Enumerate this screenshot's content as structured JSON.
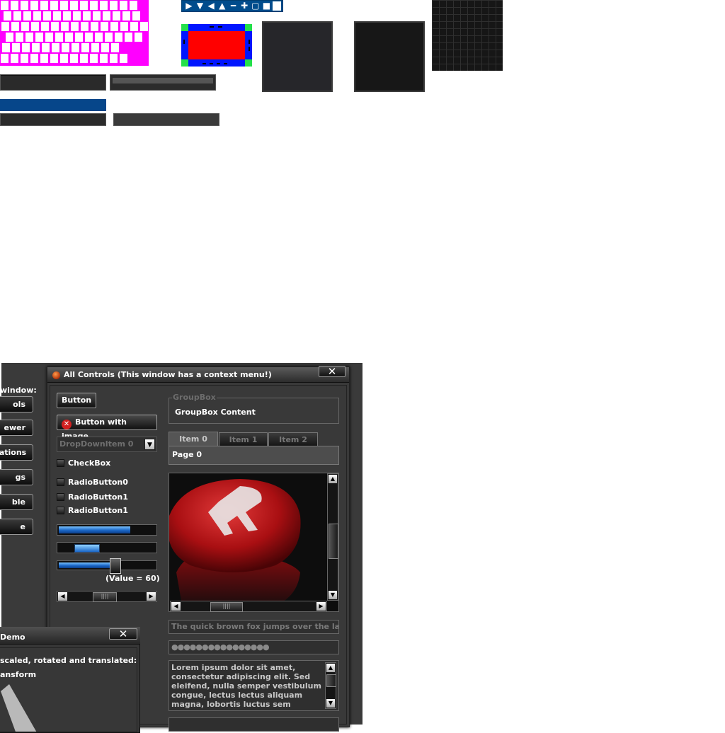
{
  "colors": {
    "magenta": "#ff00ff",
    "blue": "#004c8c",
    "red": "#ff0000",
    "green": "#23e04a",
    "dark": "#393939"
  },
  "atlas": {
    "strip_icons": [
      "triangle-right-icon",
      "triangle-down-icon",
      "triangle-left-icon",
      "triangle-up-icon",
      "minus-icon",
      "plus-icon",
      "square-outline-icon",
      "square-filled-icon"
    ],
    "strip_glyphs": [
      "▶",
      "▼",
      "◀",
      "▲",
      "━",
      "✚",
      "▢",
      "■"
    ]
  },
  "sidebar": {
    "label": "window:",
    "buttons": [
      "ols",
      "ewer",
      "nations",
      "gs",
      "ble",
      "e"
    ]
  },
  "window": {
    "title": "All Controls (This window has a context menu!)",
    "close_glyph": "✕",
    "button_label": "Button",
    "image_button_label": "Button with image",
    "image_button_icon": "✕",
    "dropdown_value": "DropDownItem 0",
    "dropdown_arrow": "▼",
    "checkbox_label": "CheckBox",
    "radio_labels": [
      "RadioButton0",
      "RadioButton1",
      "RadioButton1"
    ],
    "progress_fraction": 0.74,
    "slider_value_label": "(Value = 60)",
    "slider_fraction": 0.6,
    "groupbox_title": "GroupBox",
    "groupbox_content": "GroupBox Content",
    "tabs": [
      "Item 0",
      "Item 1",
      "Item 2"
    ],
    "tab_page": "Page 0",
    "picture_letter": "R",
    "edit_text": "The quick brown fox jumps over the lazy dog",
    "password_text": "●●●●●●●●●●●●●●●●",
    "textarea_text": "Lorem ipsum dolor sit amet, consectetur adipiscing elit. Sed eleifend, nulla semper vestibulum congue, lectus lectus aliquam magna, lobortis luctus sem magna"
  },
  "arrows": {
    "left": "◀",
    "right": "▶",
    "up": "▲",
    "down": "▼",
    "grip": "||||",
    "grip_v": "═"
  },
  "demo": {
    "title": "Demo",
    "close_glyph": "✕",
    "line1": "scaled, rotated and translated:",
    "line2": "ansform"
  }
}
